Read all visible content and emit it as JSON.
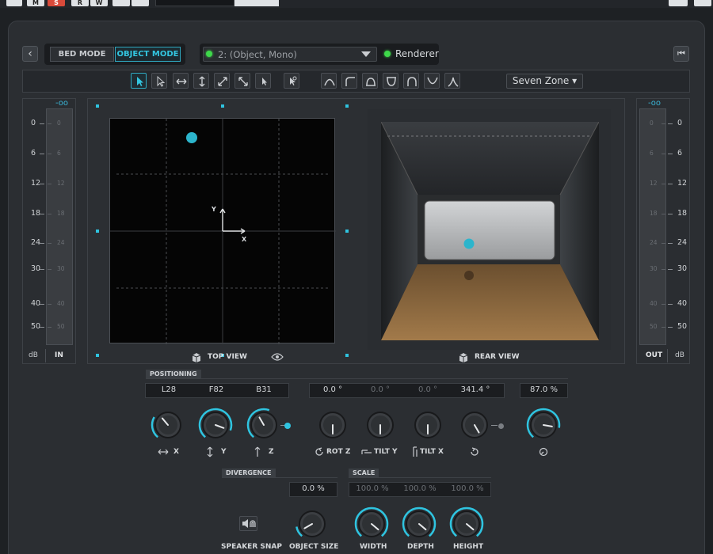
{
  "host": {
    "buttons": [
      "M",
      "S",
      "R",
      "W"
    ]
  },
  "modebar": {
    "bed_mode": "BED MODE",
    "object_mode": "OBJECT MODE",
    "object_select": "2: (Object, Mono)",
    "renderer": "Renderer"
  },
  "toolbar": {
    "zone": "Seven Zone ▾"
  },
  "meter_in": {
    "top": "-oo",
    "unit": "dB",
    "label": "IN",
    "scale": [
      "0",
      "6",
      "12",
      "18",
      "24",
      "30",
      "40",
      "50"
    ],
    "inner_scale": [
      "0",
      "6",
      "12",
      "18",
      "24",
      "30",
      "40",
      "50"
    ]
  },
  "meter_out": {
    "top": "-oo",
    "unit": "dB",
    "label": "OUT",
    "scale": [
      "0",
      "6",
      "12",
      "18",
      "24",
      "30",
      "40",
      "50"
    ],
    "inner_scale": [
      "0",
      "6",
      "12",
      "18",
      "24",
      "30",
      "40",
      "50"
    ]
  },
  "views": {
    "top_view": "TOP VIEW",
    "rear_view": "REAR VIEW",
    "axis_x": "X",
    "axis_y": "Y"
  },
  "positioning": {
    "title": "POSITIONING",
    "coords": [
      "L28",
      "F82",
      "B31"
    ],
    "angles": [
      "0.0 °",
      "0.0 °",
      "0.0 °",
      "341.4 °"
    ],
    "percent": "87.0 %",
    "knob_labels": [
      "X",
      "Y",
      "Z",
      "ROT Z",
      "TILT Y",
      "TILT X"
    ]
  },
  "divergence": {
    "title": "DIVERGENCE",
    "value": "0.0 %"
  },
  "scale": {
    "title": "SCALE",
    "values": [
      "100.0 %",
      "100.0 %",
      "100.0 %"
    ]
  },
  "bottom_labels": {
    "speaker_snap": "SPEAKER SNAP",
    "object_size": "OBJECT SIZE",
    "width": "WIDTH",
    "depth": "DEPTH",
    "height": "HEIGHT"
  },
  "colors": {
    "accent": "#2fc4e0",
    "led": "#3ed84a",
    "solo": "#d94a3a"
  }
}
